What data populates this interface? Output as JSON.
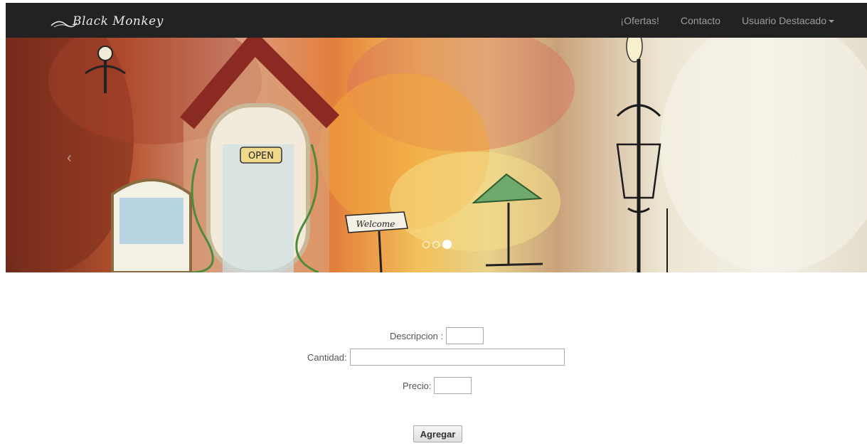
{
  "navbar": {
    "brand": "Black Monkey",
    "links": [
      "¡Ofertas!",
      "Contacto",
      "Usuario Destacado"
    ],
    "background": "#222222",
    "link_color": "#9d9d9d"
  },
  "carousel": {
    "sign_open": "OPEN",
    "sign_welcome": "Welcome",
    "indicators": 3,
    "active_indicator": 3,
    "prev_icon": "chevron-left-icon",
    "next_icon": "chevron-right-icon"
  },
  "form": {
    "descripcion_label": "Descripcion :",
    "descripcion_value": "",
    "cantidad_label": "Cantidad:",
    "cantidad_value": "",
    "precio_label": "Precio:",
    "precio_value": "",
    "submit_label": "Agregar"
  }
}
